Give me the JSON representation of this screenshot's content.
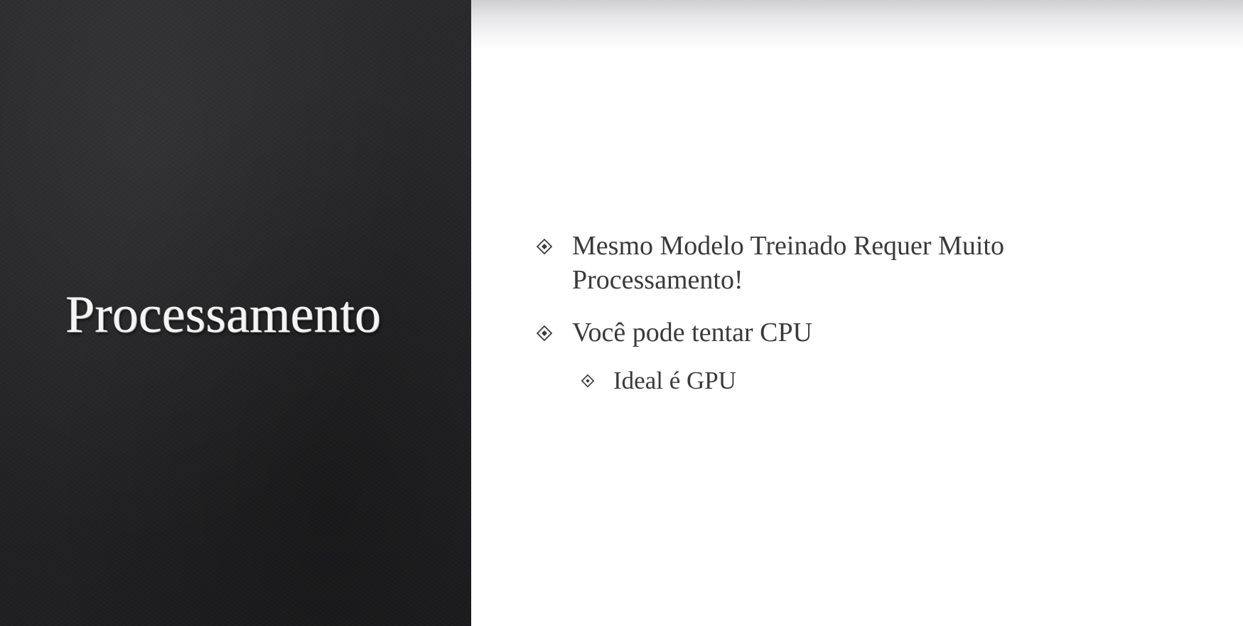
{
  "slide": {
    "title": "Processamento",
    "bullets": [
      {
        "text": "Mesmo Modelo Treinado Requer Muito Processamento!",
        "level": 1,
        "icon": "diamond-bullet-icon"
      },
      {
        "text": "Você pode tentar CPU",
        "level": 1,
        "icon": "diamond-bullet-icon"
      },
      {
        "text": "Ideal é GPU",
        "level": 2,
        "icon": "diamond-bullet-icon"
      }
    ]
  },
  "colors": {
    "left_panel": "#262628",
    "title_text": "#f4f4f4",
    "body_text": "#3a3a3a",
    "background": "#ffffff"
  }
}
